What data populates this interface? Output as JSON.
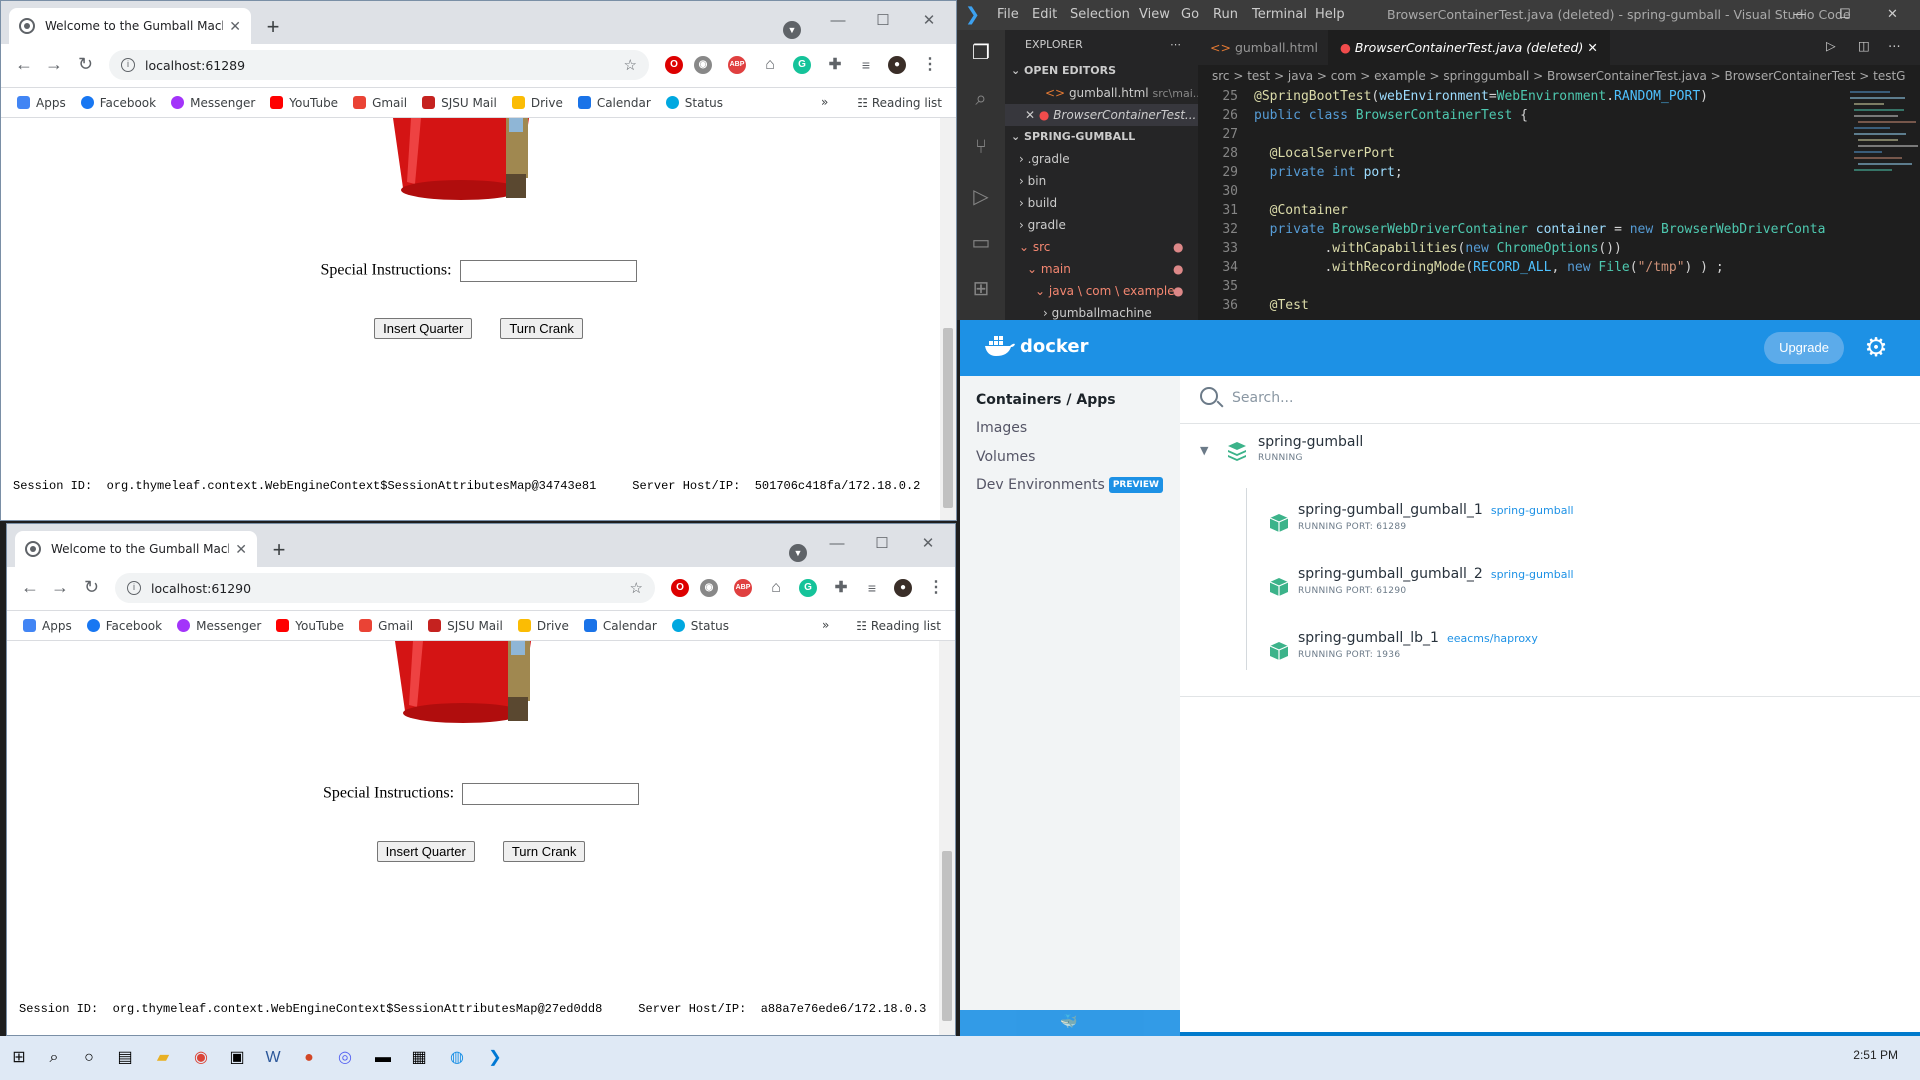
{
  "browser_top": {
    "tab_title": "Welcome to the Gumball Machin",
    "url": "localhost:61289",
    "special_label": "Special Instructions:",
    "insert_quarter": "Insert Quarter",
    "turn_crank": "Turn Crank",
    "session_text": "Session ID:  org.thymeleaf.context.WebEngineContext$SessionAttributesMap@34743e81     Server Host/IP:  501706c418fa/172.18.0.2"
  },
  "browser_bottom": {
    "tab_title": "Welcome to the Gumball Machin",
    "url": "localhost:61290",
    "special_label": "Special Instructions:",
    "insert_quarter": "Insert Quarter",
    "turn_crank": "Turn Crank",
    "session_text": "Session ID:  org.thymeleaf.context.WebEngineContext$SessionAttributesMap@27ed0dd8     Server Host/IP:  a88a7e76ede6/172.18.0.3"
  },
  "bookmarks": [
    "Apps",
    "Facebook",
    "Messenger",
    "YouTube",
    "Gmail",
    "SJSU Mail",
    "Drive",
    "Calendar",
    "Status"
  ],
  "reading_list": "Reading list",
  "vscode": {
    "menu": [
      "File",
      "Edit",
      "Selection",
      "View",
      "Go",
      "Run",
      "Terminal",
      "Help"
    ],
    "title": "BrowserContainerTest.java (deleted) - spring-gumball - Visual Studio Code",
    "explorer_title": "EXPLORER",
    "open_editors": "OPEN EDITORS",
    "open_file_1": "gumball.html",
    "open_file_1_path": "src\\mai...",
    "open_file_2": "BrowserContainerTest...",
    "project": "SPRING-GUMBALL",
    "tree": [
      ".gradle",
      "bin",
      "build",
      "gradle",
      "src",
      "main",
      "java \\ com \\ example",
      "gumballmachine"
    ],
    "tab1": "gumball.html",
    "tab2": "BrowserContainerTest.java (deleted)",
    "breadcrumb": "src  >  test  >  java  >  com  >  example  >  springgumball  >  BrowserContainerTest.java  >  BrowserContainerTest  >  testG",
    "line_numbers": [
      "25",
      "26",
      "27",
      "28",
      "29",
      "30",
      "31",
      "32",
      "33",
      "34",
      "35",
      "36"
    ]
  },
  "docker": {
    "brand": "docker",
    "upgrade": "Upgrade",
    "nav": [
      "Containers / Apps",
      "Images",
      "Volumes",
      "Dev Environments"
    ],
    "preview_badge": "PREVIEW",
    "search_placeholder": "Search...",
    "app_name": "spring-gumball",
    "app_status": "RUNNING",
    "containers": [
      {
        "name": "spring-gumball_gumball_1",
        "image": "spring-gumball",
        "status": "RUNNING   PORT: 61289"
      },
      {
        "name": "spring-gumball_gumball_2",
        "image": "spring-gumball",
        "status": "RUNNING   PORT: 61290"
      },
      {
        "name": "spring-gumball_lb_1",
        "image": "eeacms/haproxy",
        "status": "RUNNING   PORT: 1936"
      }
    ]
  },
  "taskbar": {
    "clock": "2:51 PM"
  }
}
